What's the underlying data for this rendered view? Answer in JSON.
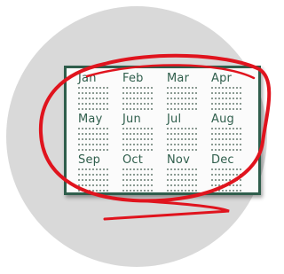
{
  "calendar": {
    "months": [
      "Jan",
      "Feb",
      "Mar",
      "Apr",
      "May",
      "Jun",
      "Jul",
      "Aug",
      "Sep",
      "Oct",
      "Nov",
      "Dec"
    ],
    "accent_color": "#2f5e4c",
    "annotation_color": "#e0141e",
    "backdrop_color": "#d9d9d9"
  }
}
